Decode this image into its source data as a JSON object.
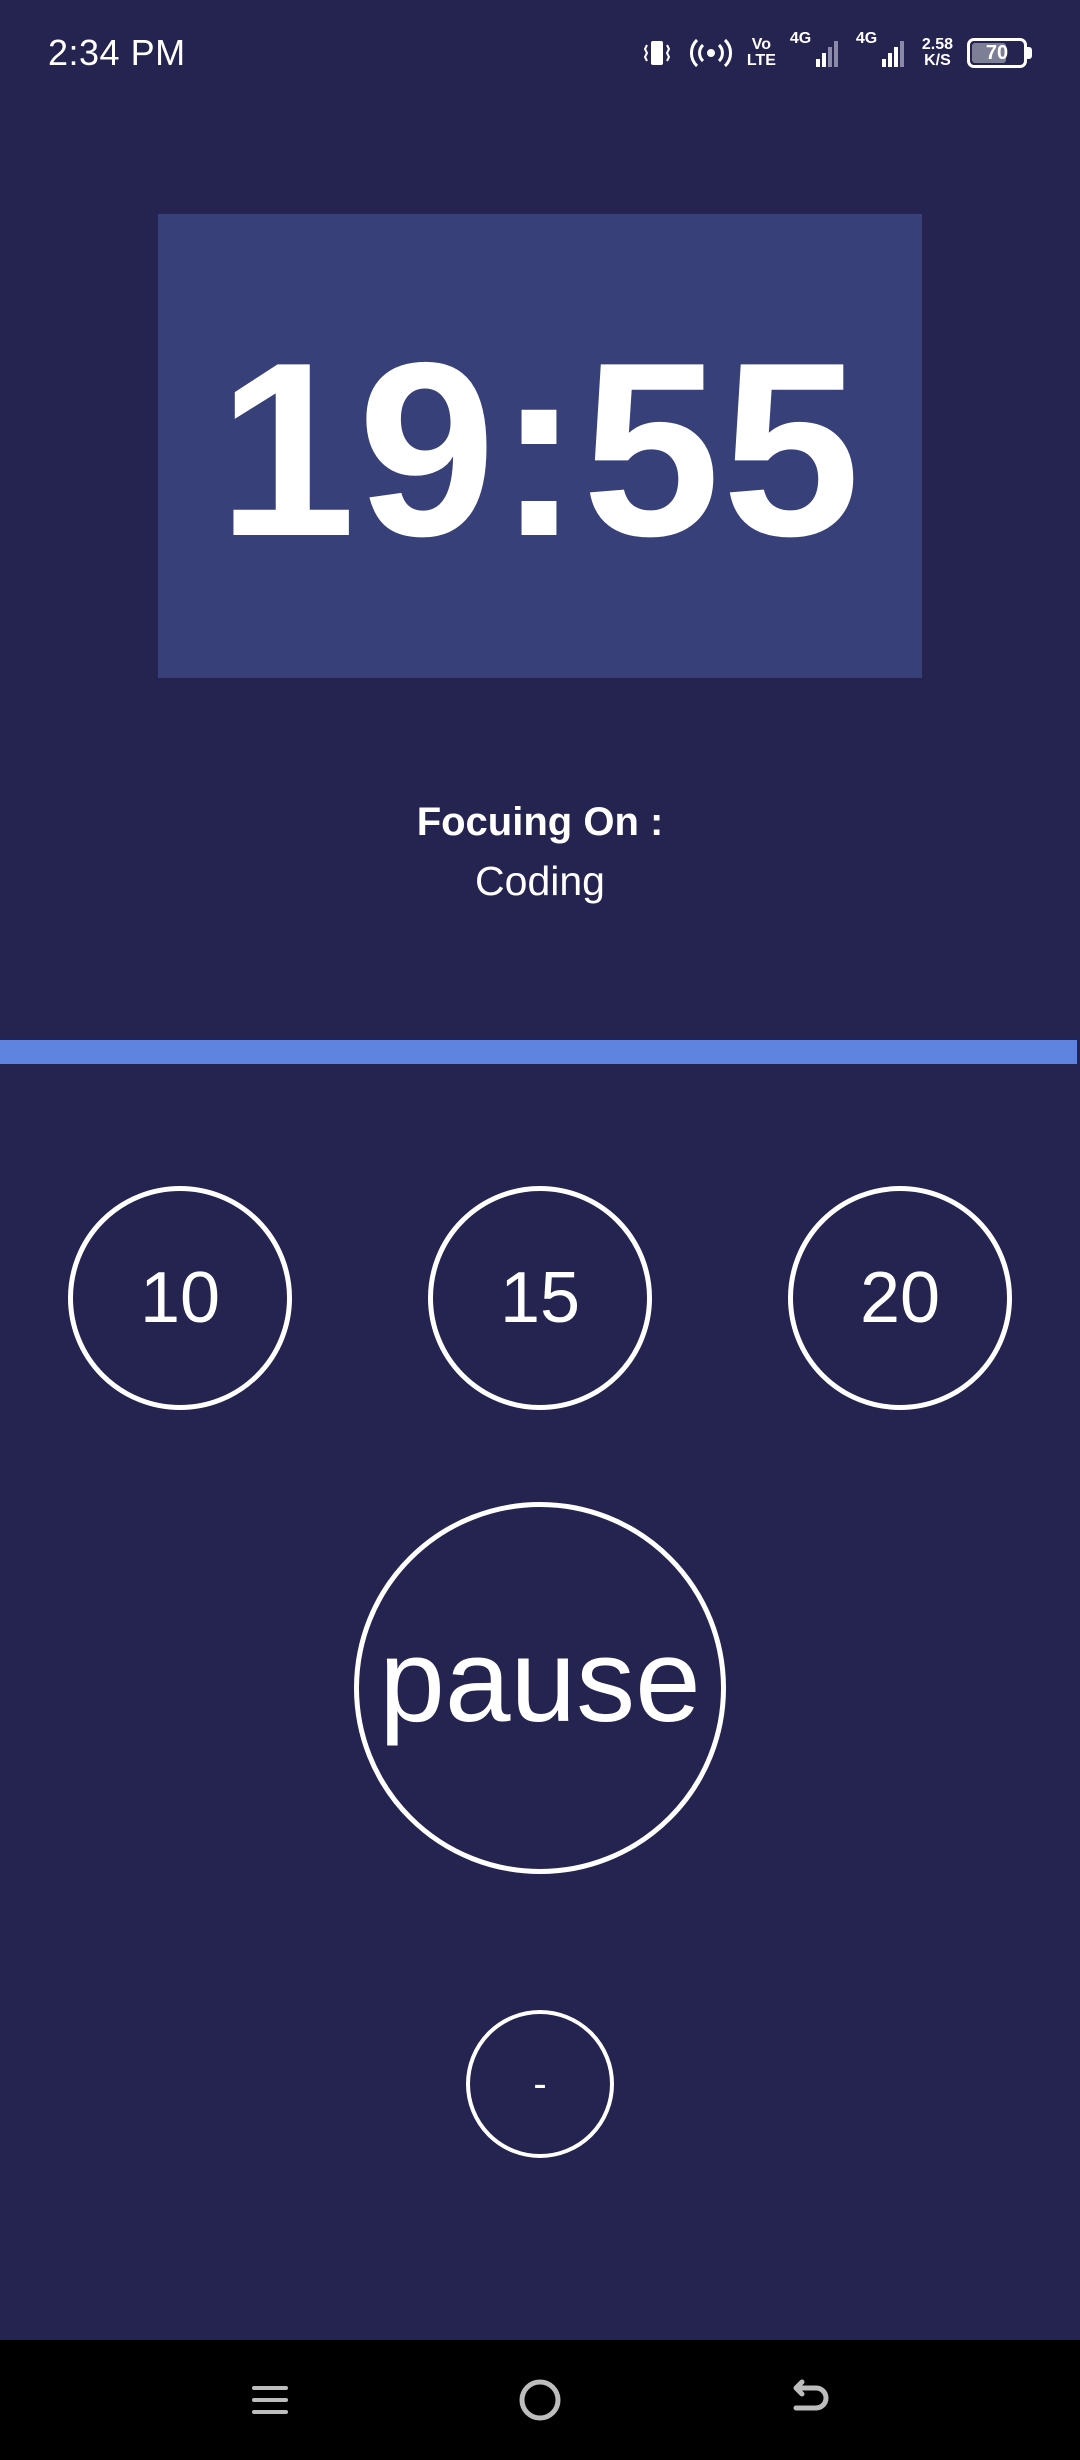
{
  "status_bar": {
    "time": "2:34 PM",
    "volte_top": "Vo",
    "volte_bottom": "LTE",
    "net1": "4G",
    "net2": "4G",
    "speed_value": "2.58",
    "speed_unit": "K/S",
    "battery": "70",
    "battery_level": 0.7,
    "icons": [
      "vibrate-icon",
      "hotspot-icon",
      "volte-icon",
      "signal-icon",
      "signal-icon",
      "battery-icon"
    ]
  },
  "timer": {
    "display": "19:55"
  },
  "focus": {
    "label": "Focuing On :",
    "value": "Coding"
  },
  "progress": {
    "fraction": 0.997
  },
  "presets": [
    "10",
    "15",
    "20"
  ],
  "controls": {
    "pause_label": "pause",
    "minus_label": "-"
  },
  "nav": {
    "icons": [
      "menu-icon",
      "home-icon",
      "back-icon"
    ]
  },
  "colors": {
    "background": "#252350",
    "timer_box": "#374079",
    "progress": "#5f84e0",
    "nav_bar": "#000000"
  }
}
